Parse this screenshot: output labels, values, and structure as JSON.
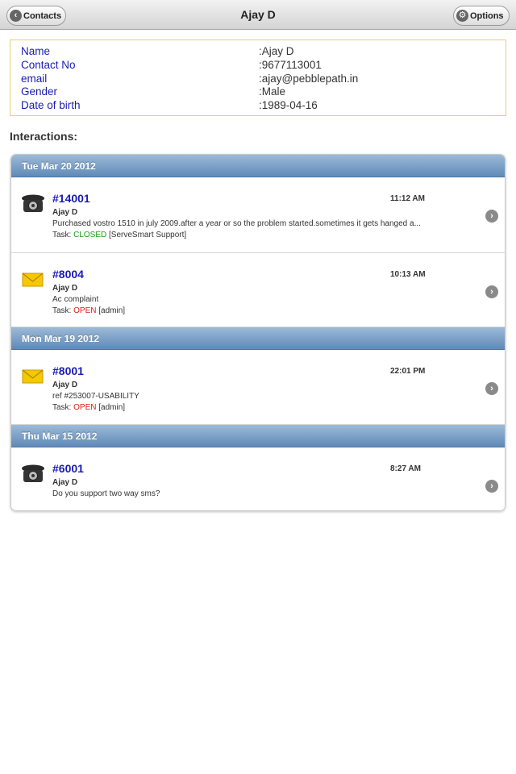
{
  "navbar": {
    "title": "Ajay D",
    "back_label": "Contacts",
    "options_label": "Options"
  },
  "contact": {
    "fields": [
      {
        "label": "Name",
        "value": ":Ajay D"
      },
      {
        "label": "Contact No",
        "value": ":9677113001"
      },
      {
        "label": "email",
        "value": ":ajay@pebblepath.in"
      },
      {
        "label": "Gender",
        "value": ":Male"
      },
      {
        "label": "Date of birth",
        "value": ":1989-04-16"
      }
    ]
  },
  "interactions_title": "Interactions:",
  "groups": [
    {
      "date": "Tue Mar 20 2012",
      "items": [
        {
          "icon": "telephone-icon",
          "id": "#14001",
          "time": "11:12 AM",
          "name": "Ajay D",
          "desc": "Purchased vostro 1510 in july 2009.after a year or so the problem started.sometimes it gets hanged a...",
          "task_prefix": "Task: ",
          "task_status": "CLOSED",
          "task_owner": " [ServeSmart Support]"
        },
        {
          "icon": "envelope-icon",
          "id": "#8004",
          "time": "10:13 AM",
          "name": "Ajay D",
          "desc": "Ac complaint",
          "task_prefix": "Task: ",
          "task_status": "OPEN",
          "task_owner": " [admin]"
        }
      ]
    },
    {
      "date": "Mon Mar 19 2012",
      "items": [
        {
          "icon": "envelope-icon",
          "id": "#8001",
          "time": "22:01 PM",
          "name": "Ajay D",
          "desc": "ref #253007-USABILITY",
          "task_prefix": "Task: ",
          "task_status": "OPEN",
          "task_owner": " [admin]"
        }
      ]
    },
    {
      "date": "Thu Mar 15 2012",
      "items": [
        {
          "icon": "telephone-icon",
          "id": "#6001",
          "time": "8:27 AM",
          "name": "Ajay D",
          "desc": "Do you support two way sms?"
        }
      ]
    }
  ],
  "colors": {
    "link_blue": "#1a1ab5",
    "closed_green": "#1c9a1c",
    "open_red": "#e01b1b",
    "group_header_top": "#9dbad8",
    "group_header_bottom": "#5f8ab8",
    "details_border": "#e8cf73"
  }
}
